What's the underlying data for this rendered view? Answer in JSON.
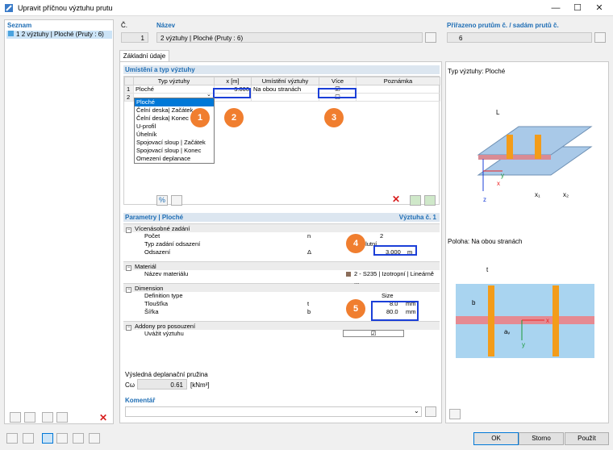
{
  "window": {
    "title": "Upravit příčnou výztuhu prutu",
    "min": "—",
    "max": "☐",
    "close": "✕"
  },
  "list": {
    "header": "Seznam",
    "item_no": "1",
    "item_label": "2 výztuhy | Ploché (Pruty : 6)"
  },
  "fields": {
    "no_label": "Č.",
    "no_value": "1",
    "name_label": "Název",
    "name_value": "2 výztuhy | Ploché (Pruty : 6)",
    "assigned_label": "Přiřazeno prutům č. / sadám prutů č.",
    "assigned_value": "6"
  },
  "tab": "Základní údaje",
  "placement": {
    "header": "Umístění a typ výztuhy",
    "cols": [
      "Typ výztuhy",
      "x [m]",
      "Umístění výztuhy",
      "Více",
      "Poznámka"
    ],
    "rows": [
      {
        "no": "1",
        "type": "Ploché",
        "x": "3.000",
        "loc": "Na obou stranách"
      },
      {
        "no": "2",
        "type": "",
        "x": "",
        "loc": ""
      }
    ]
  },
  "dropdown": [
    "Ploché",
    "Čelní deska| Začátek",
    "Čelní deska| Konec",
    "U-profil",
    "Úhelník",
    "Spojovací sloup | Začátek",
    "Spojovací sloup | Konec",
    "Omezení deplanace"
  ],
  "badges": [
    "1",
    "2",
    "3",
    "4",
    "5"
  ],
  "params": {
    "header": "Parametry | Ploché",
    "right": "Výztuha č. 1",
    "g1": "Vícenásobné zadání",
    "count_label": "Počet",
    "count_sym": "n",
    "count_val": "2",
    "offtype_label": "Typ zadání odsazení",
    "offtype_val": "Absolutní",
    "offset_label": "Odsazení",
    "offset_sym": "Δ",
    "offset_val": "3.000",
    "offset_unit": "m",
    "g2": "Materiál",
    "mat_label": "Název materiálu",
    "mat_val": "2 - S235 | Izotropní | Lineárně ...",
    "g3": "Dimension",
    "def_label": "Definition type",
    "def_val": "Size",
    "t_label": "Tloušťka",
    "t_sym": "t",
    "t_val": "8.0",
    "t_unit": "mm",
    "b_label": "Šířka",
    "b_sym": "b",
    "b_val": "80.0",
    "b_unit": "mm",
    "g4": "Addony pro posouzení",
    "addon_label": "Uvážit výztuhu"
  },
  "spring": {
    "label": "Výsledná deplanační pružina",
    "sym": "Cω",
    "val": "0.61",
    "unit": "[kNm³]"
  },
  "comment": {
    "label": "Komentář"
  },
  "preview": {
    "title1": "Typ výztuhy: Ploché",
    "title2": "Poloha: Na obou stranách",
    "L": "L",
    "x1": "x₁",
    "x2": "x₂",
    "x": "x",
    "y": "y",
    "z": "z",
    "t": "t",
    "b": "b",
    "a": "aᵥ"
  },
  "buttons": {
    "ok": "OK",
    "cancel": "Storno",
    "apply": "Použít"
  }
}
